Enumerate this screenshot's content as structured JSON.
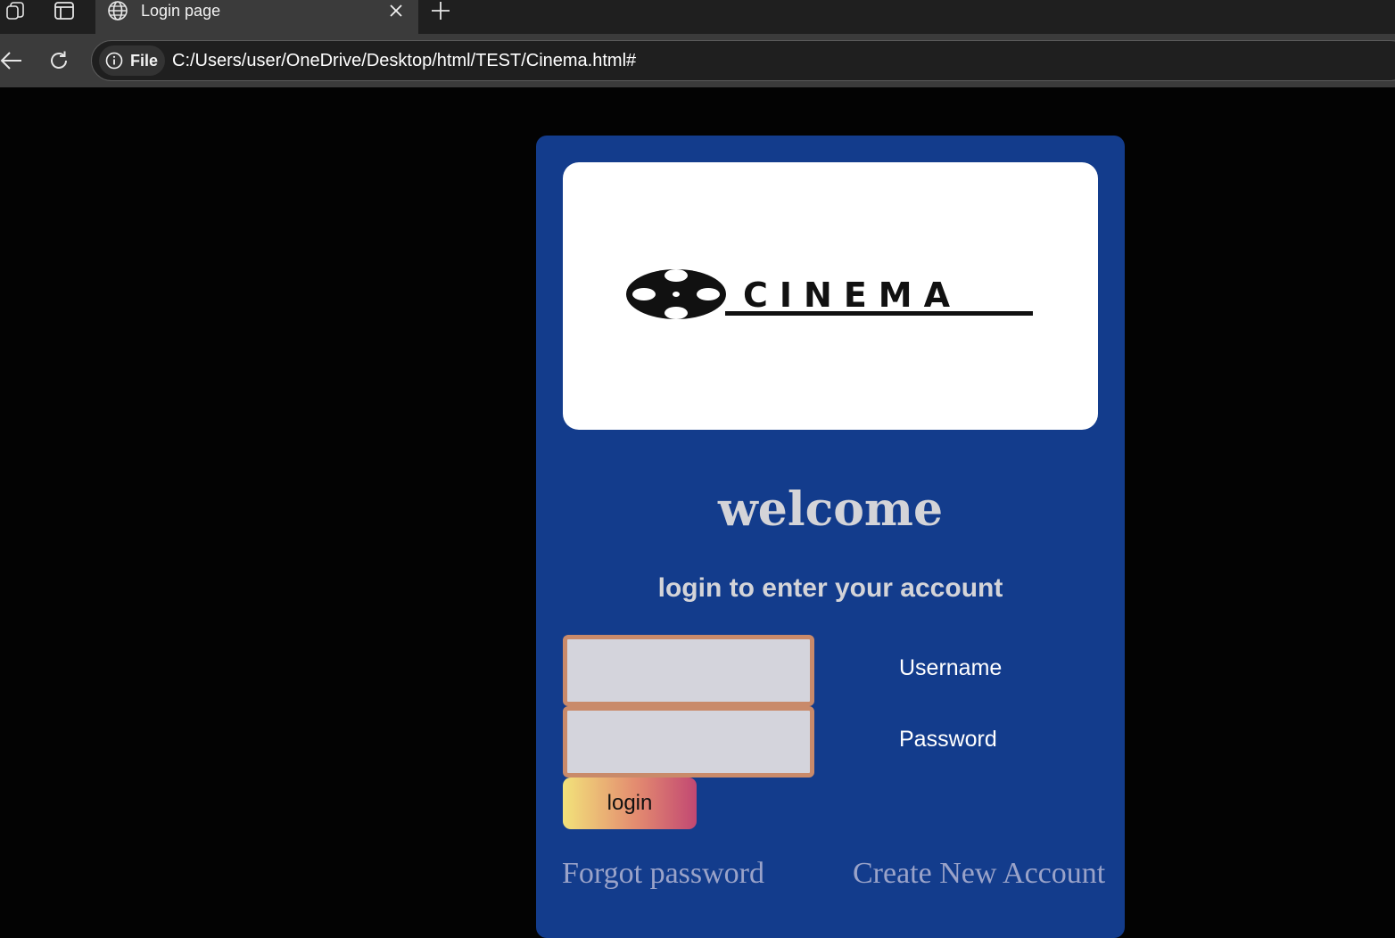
{
  "browser": {
    "tab": {
      "title": "Login page"
    },
    "address": {
      "site_info_label": "File",
      "url": "C:/Users/user/OneDrive/Desktop/html/TEST/Cinema.html#"
    },
    "icons": [
      "workspaces-icon",
      "tab-actions-icon",
      "globe-icon",
      "close-icon",
      "new-tab-icon",
      "back-icon",
      "refresh-icon",
      "info-icon"
    ]
  },
  "page": {
    "logo": {
      "text": "CINEMA"
    },
    "heading": "welcome",
    "subheading": "login to enter your account",
    "form": {
      "username_label": "Username",
      "password_label": "Password",
      "username_value": "",
      "password_value": "",
      "login_label": "login"
    },
    "links": {
      "forgot_password": "Forgot password",
      "create_account": "Create New Account"
    }
  },
  "colors": {
    "page_background": "#030303",
    "card_background": "#133c8c",
    "input_border": "#c98a6a",
    "input_fill": "#d4d4dc",
    "heading_text": "#d4d4d8",
    "link_text": "#9aa3c9",
    "button_gradient_start": "#f2e27a",
    "button_gradient_end": "#c24872"
  }
}
